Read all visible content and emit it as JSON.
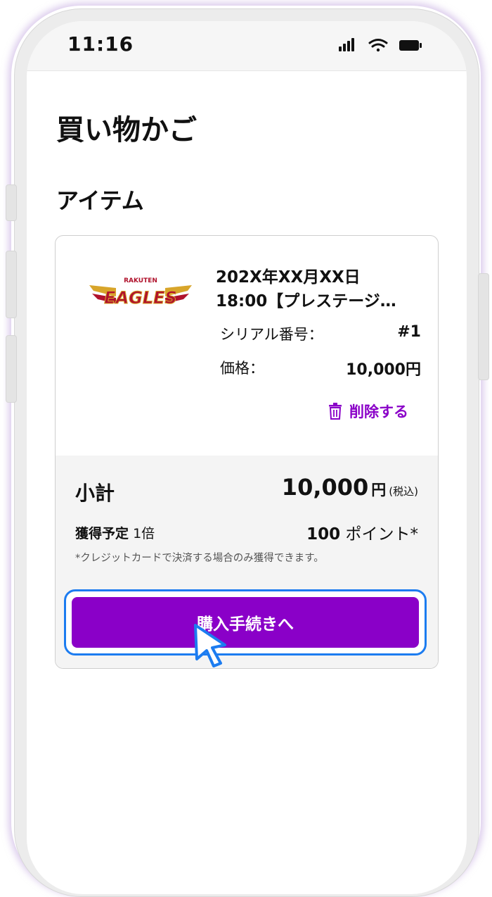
{
  "status_bar": {
    "time": "11:16"
  },
  "page": {
    "title": "買い物かご",
    "section_title": "アイテム"
  },
  "item": {
    "logo_text": {
      "top": "RAKUTEN",
      "main": "EAGLES"
    },
    "title_line1": "202X年XX月XX日",
    "title_line2": "18:00【プレステージ…",
    "serial_label": "シリアル番号：",
    "serial_value": "#1",
    "price_label": "価格：",
    "price_value": "10,000円",
    "delete_label": "削除する"
  },
  "summary": {
    "subtotal_label": "小計",
    "subtotal_amount": "10,000",
    "subtotal_unit": "円",
    "subtotal_tax": "(税込)",
    "points_label": "獲得予定",
    "points_multiplier": "1倍",
    "points_amount": "100",
    "points_unit": "ポイント*",
    "note": "*クレジットカードで決済する場合のみ獲得できます。",
    "checkout_label": "購入手続きへ"
  },
  "colors": {
    "accent": "#8a00c8",
    "focus": "#1c7cf0",
    "logo_red": "#b0122c",
    "logo_gold": "#d8a52a"
  },
  "icons": [
    "signal-icon",
    "wifi-icon",
    "battery-icon",
    "trash-icon",
    "pointer-cursor-icon"
  ]
}
